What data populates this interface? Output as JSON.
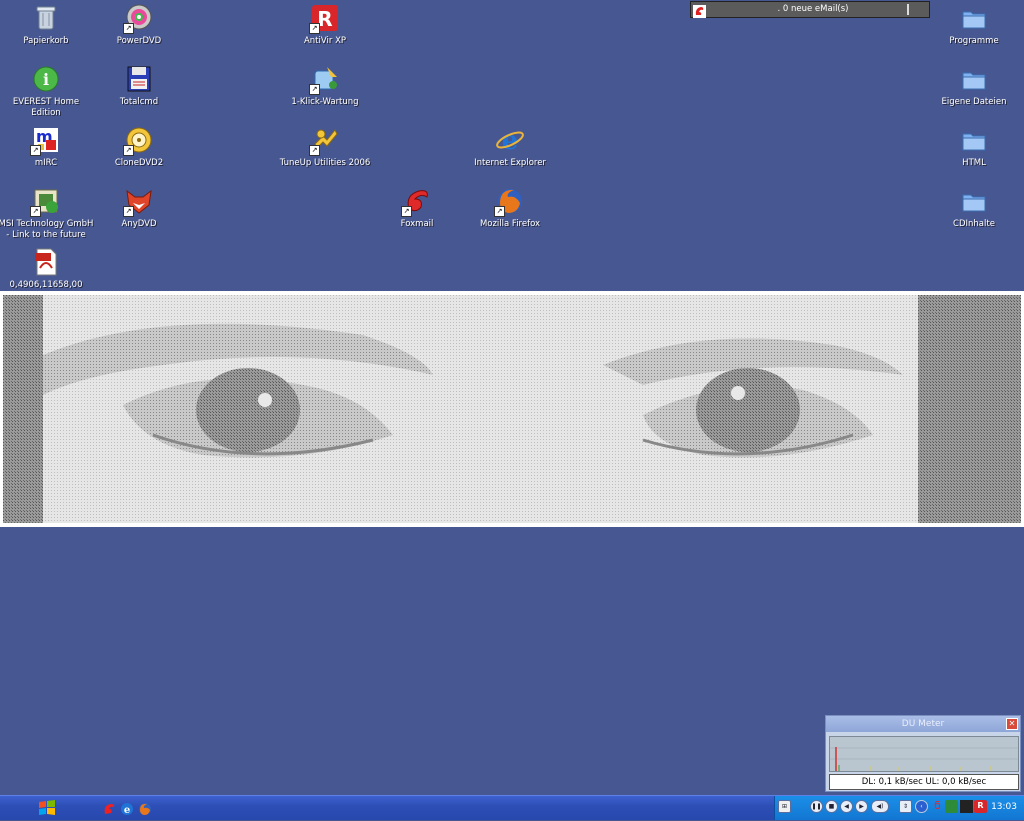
{
  "desktop": {
    "icons": {
      "papierkorb": "Papierkorb",
      "powerdvd": "PowerDVD",
      "antivir": "AntiVir XP",
      "everest": "EVEREST Home Edition",
      "totalcmd": "Totalcmd",
      "klick": "1-Klick-Wartung",
      "mirc": "mIRC",
      "clonedvd": "CloneDVD2",
      "tuneup": "TuneUp Utilities 2006",
      "ie": "Internet Explorer",
      "msi": "MSI Technology GmbH - Link to the future",
      "anydvd": "AnyDVD",
      "foxmail": "Foxmail",
      "firefox": "Mozilla Firefox",
      "pdf": "0,4906,11658,00",
      "programme": "Programme",
      "eigene": "Eigene Dateien",
      "html": "HTML",
      "cdinhalte": "CDInhalte"
    },
    "colors": {
      "background": "#465791",
      "folder": "#7fb0ef"
    }
  },
  "mail_notifier": {
    "text": ". 0 neue eMail(s)"
  },
  "du_meter": {
    "title": "DU Meter",
    "stats": "DL: 0,1 kB/sec  UL: 0,0 kB/sec"
  },
  "taskbar": {
    "clock": "13:03"
  }
}
